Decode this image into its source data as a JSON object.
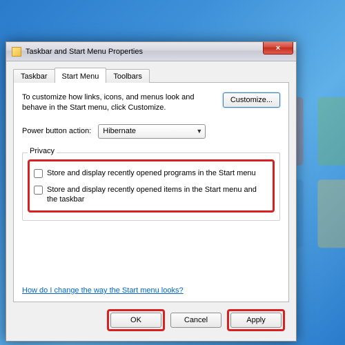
{
  "window": {
    "title": "Taskbar and Start Menu Properties",
    "close_icon": "×"
  },
  "tabs": {
    "taskbar": "Taskbar",
    "startmenu": "Start Menu",
    "toolbars": "Toolbars"
  },
  "startmenu_tab": {
    "description": "To customize how links, icons, and menus look and behave in the Start menu, click Customize.",
    "customize_label": "Customize...",
    "power_label": "Power button action:",
    "power_value": "Hibernate",
    "privacy_legend": "Privacy",
    "check1": "Store and display recently opened programs in the Start menu",
    "check2": "Store and display recently opened items in the Start menu and the taskbar",
    "help_link": "How do I change the way the Start menu looks?"
  },
  "footer": {
    "ok": "OK",
    "cancel": "Cancel",
    "apply": "Apply"
  }
}
